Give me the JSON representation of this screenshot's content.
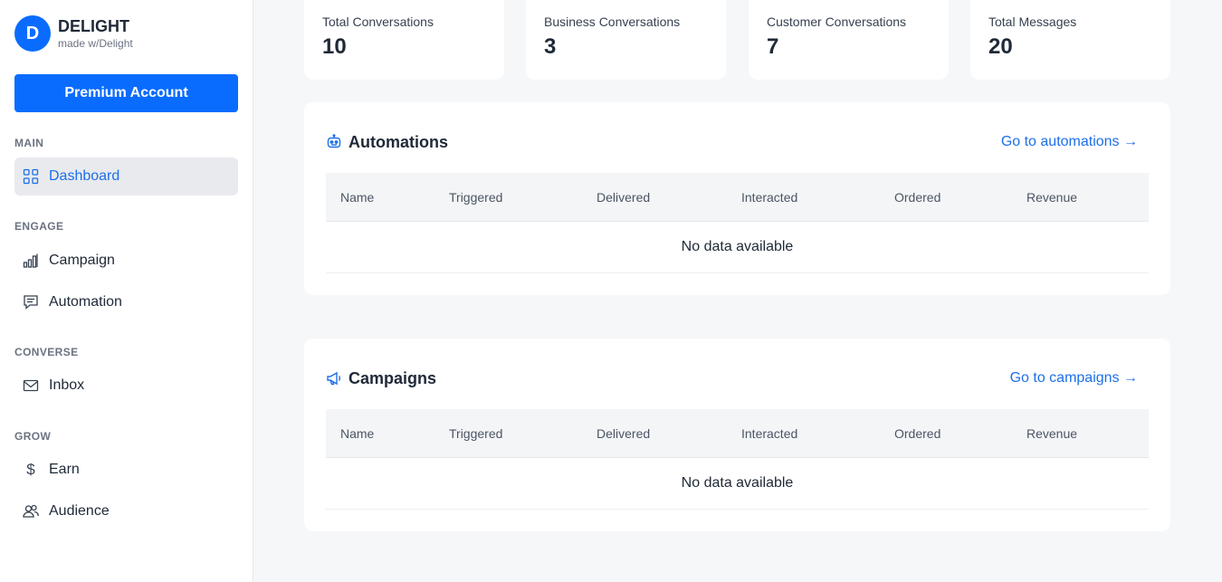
{
  "brand": {
    "logo_letter": "D",
    "name": "DELIGHT",
    "subtitle": "made w/Delight"
  },
  "sidebar": {
    "premium_label": "Premium Account",
    "sections": {
      "main": "MAIN",
      "engage": "ENGAGE",
      "converse": "CONVERSE",
      "grow": "GROW"
    },
    "items": {
      "dashboard": "Dashboard",
      "campaign": "Campaign",
      "automation": "Automation",
      "inbox": "Inbox",
      "earn": "Earn",
      "audience": "Audience"
    }
  },
  "stats": [
    {
      "label": "Total Conversations",
      "value": "10"
    },
    {
      "label": "Business Conversations",
      "value": "3"
    },
    {
      "label": "Customer Conversations",
      "value": "7"
    },
    {
      "label": "Total Messages",
      "value": "20"
    }
  ],
  "automations": {
    "title": "Automations",
    "link": "Go to automations →",
    "columns": [
      "Name",
      "Triggered",
      "Delivered",
      "Interacted",
      "Ordered",
      "Revenue"
    ],
    "empty": "No data available"
  },
  "campaigns": {
    "title": "Campaigns",
    "link": "Go to campaigns →",
    "columns": [
      "Name",
      "Triggered",
      "Delivered",
      "Interacted",
      "Ordered",
      "Revenue"
    ],
    "empty": "No data available"
  },
  "colors": {
    "accent": "#0a6cff",
    "link": "#1d6fe8",
    "active_bg": "#e8eaee",
    "page_bg": "#f6f7f9"
  }
}
